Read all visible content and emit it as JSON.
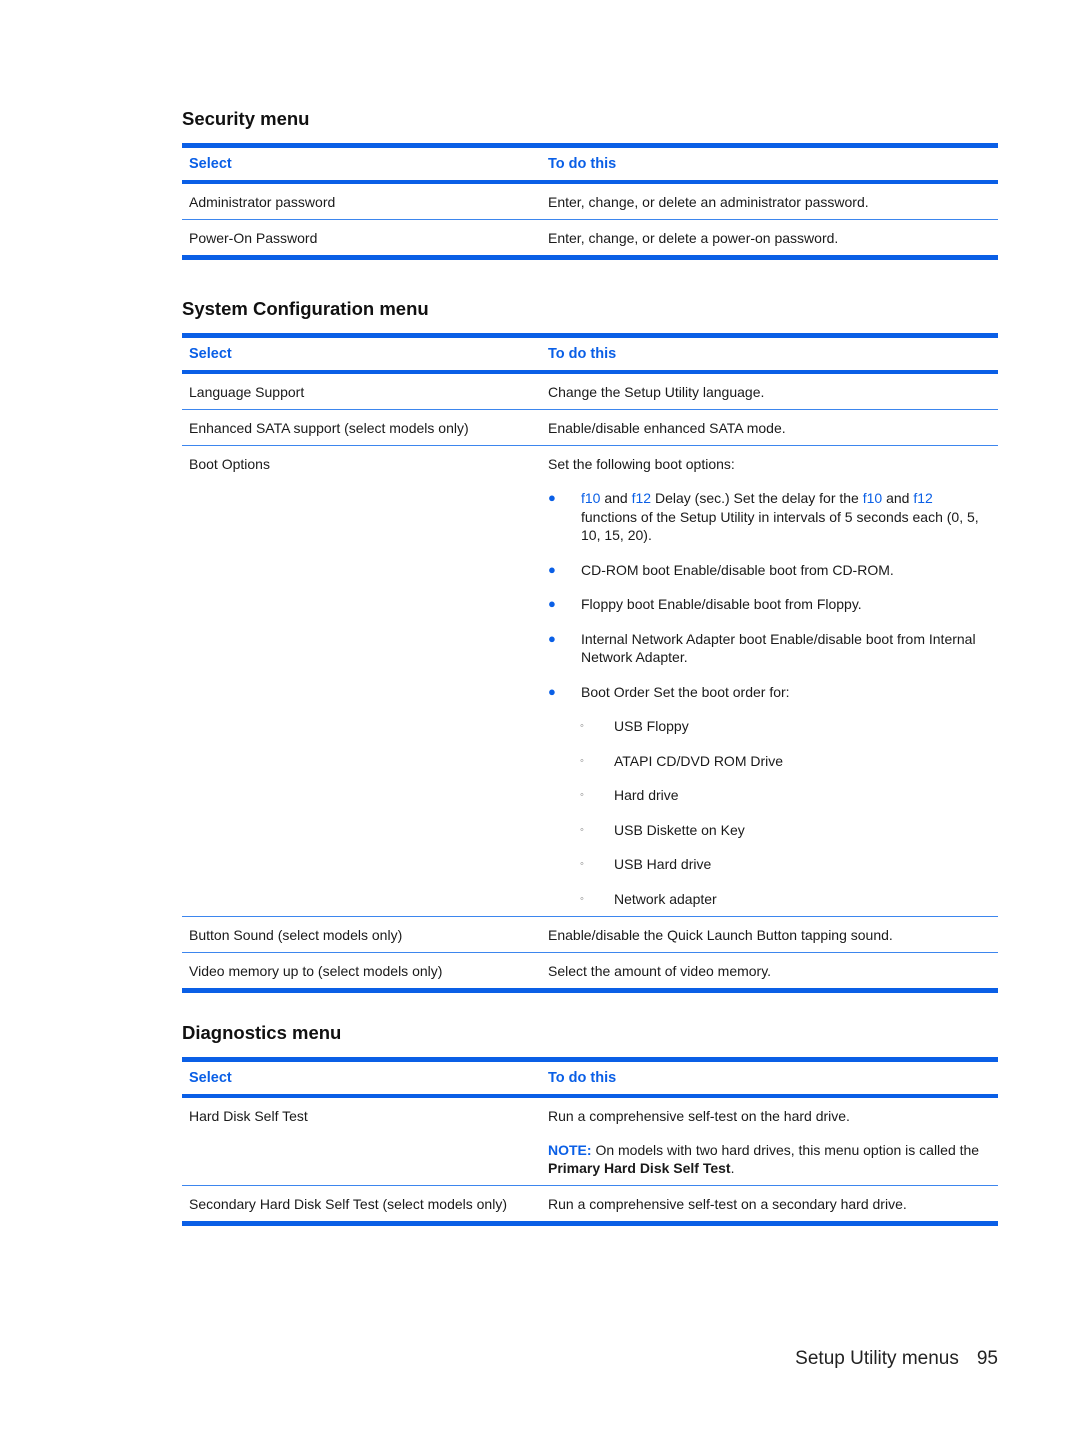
{
  "security": {
    "title": "Security menu",
    "headers": [
      "Select",
      "To do this"
    ],
    "rows": [
      {
        "select": "Administrator password",
        "action": "Enter, change, or delete an administrator password."
      },
      {
        "select": "Power-On Password",
        "action": "Enter, change, or delete a power-on password."
      }
    ]
  },
  "sysconfig": {
    "title": "System Configuration menu",
    "headers": [
      "Select",
      "To do this"
    ],
    "rows": [
      {
        "select": "Language Support",
        "action": "Change the Setup Utility language."
      },
      {
        "select": "Enhanced SATA support (select models only)",
        "action": "Enable/disable enhanced SATA mode."
      },
      {
        "select": "Boot Options",
        "action": "Set the following boot options:"
      },
      {
        "select": "Button Sound (select models only)",
        "action": "Enable/disable the Quick Launch Button tapping sound."
      },
      {
        "select": "Video memory up to (select models only)",
        "action": "Select the amount of video memory."
      }
    ],
    "boot": {
      "delay": {
        "key1": "f10",
        "and": " and ",
        "key2": "f12",
        "mid": " Delay (sec.)  Set the delay for the ",
        "key3": "f10",
        "and2": " and ",
        "key4": "f12",
        "rest": " functions of the Setup Utility in intervals of 5 seconds each (0, 5, 10, 15, 20)."
      },
      "items": [
        "CD-ROM boot  Enable/disable boot from CD-ROM.",
        "Floppy boot  Enable/disable boot from Floppy.",
        "Internal Network Adapter boot  Enable/disable boot from Internal Network Adapter.",
        "Boot Order  Set the boot order for:"
      ],
      "order": [
        "USB Floppy",
        "ATAPI CD/DVD ROM Drive",
        "Hard drive",
        "USB Diskette on Key",
        "USB Hard drive",
        "Network adapter"
      ]
    }
  },
  "diagnostics": {
    "title": "Diagnostics menu",
    "headers": [
      "Select",
      "To do this"
    ],
    "rows": [
      {
        "select": "Hard Disk Self Test",
        "action": "Run a comprehensive self-test on the hard drive."
      },
      {
        "select": "Secondary Hard Disk Self Test (select models only)",
        "action": "Run a comprehensive self-test on a secondary hard drive."
      }
    ],
    "note": {
      "label": "NOTE:",
      "text": "  On models with two hard drives, this menu option is called the ",
      "bold": "Primary Hard Disk Self Test",
      "end": "."
    }
  },
  "footer": {
    "section": "Setup Utility menus",
    "page": "95"
  },
  "colors": {
    "accent": "#0a5fe6"
  }
}
